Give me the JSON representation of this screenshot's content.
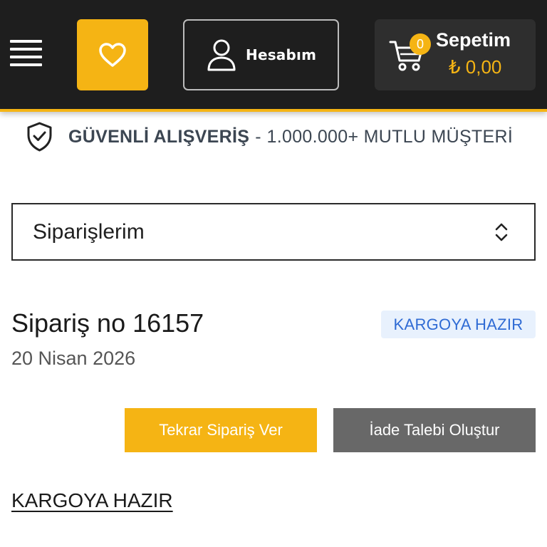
{
  "header": {
    "menu_icon": "hamburger-menu-icon",
    "favorites_icon": "heart-icon",
    "account": {
      "icon": "user-icon",
      "label": "Hesabım"
    },
    "cart": {
      "icon": "shopping-cart-icon",
      "count": "0",
      "title": "Sepetim",
      "total": "₺ 0,00"
    },
    "colors": {
      "background": "#1e1e1e",
      "accent": "#f5b414"
    }
  },
  "trust_bar": {
    "icon": "shield-check-icon",
    "strong": "GÜVENLİ ALIŞVERİŞ",
    "separator": "-",
    "rest": "1.000.000+ MUTLU MÜŞTERİ"
  },
  "section_select": {
    "value": "Siparişlerim",
    "icon": "chevron-up-down-icon"
  },
  "order": {
    "title": "Sipariş no 16157",
    "date": "20 Nisan 2026",
    "status": "KARGOYA HAZIR",
    "actions": {
      "reorder": "Tekrar Sipariş Ver",
      "return": "İade Talebi Oluştur"
    },
    "status_link": "KARGOYA HAZIR"
  }
}
